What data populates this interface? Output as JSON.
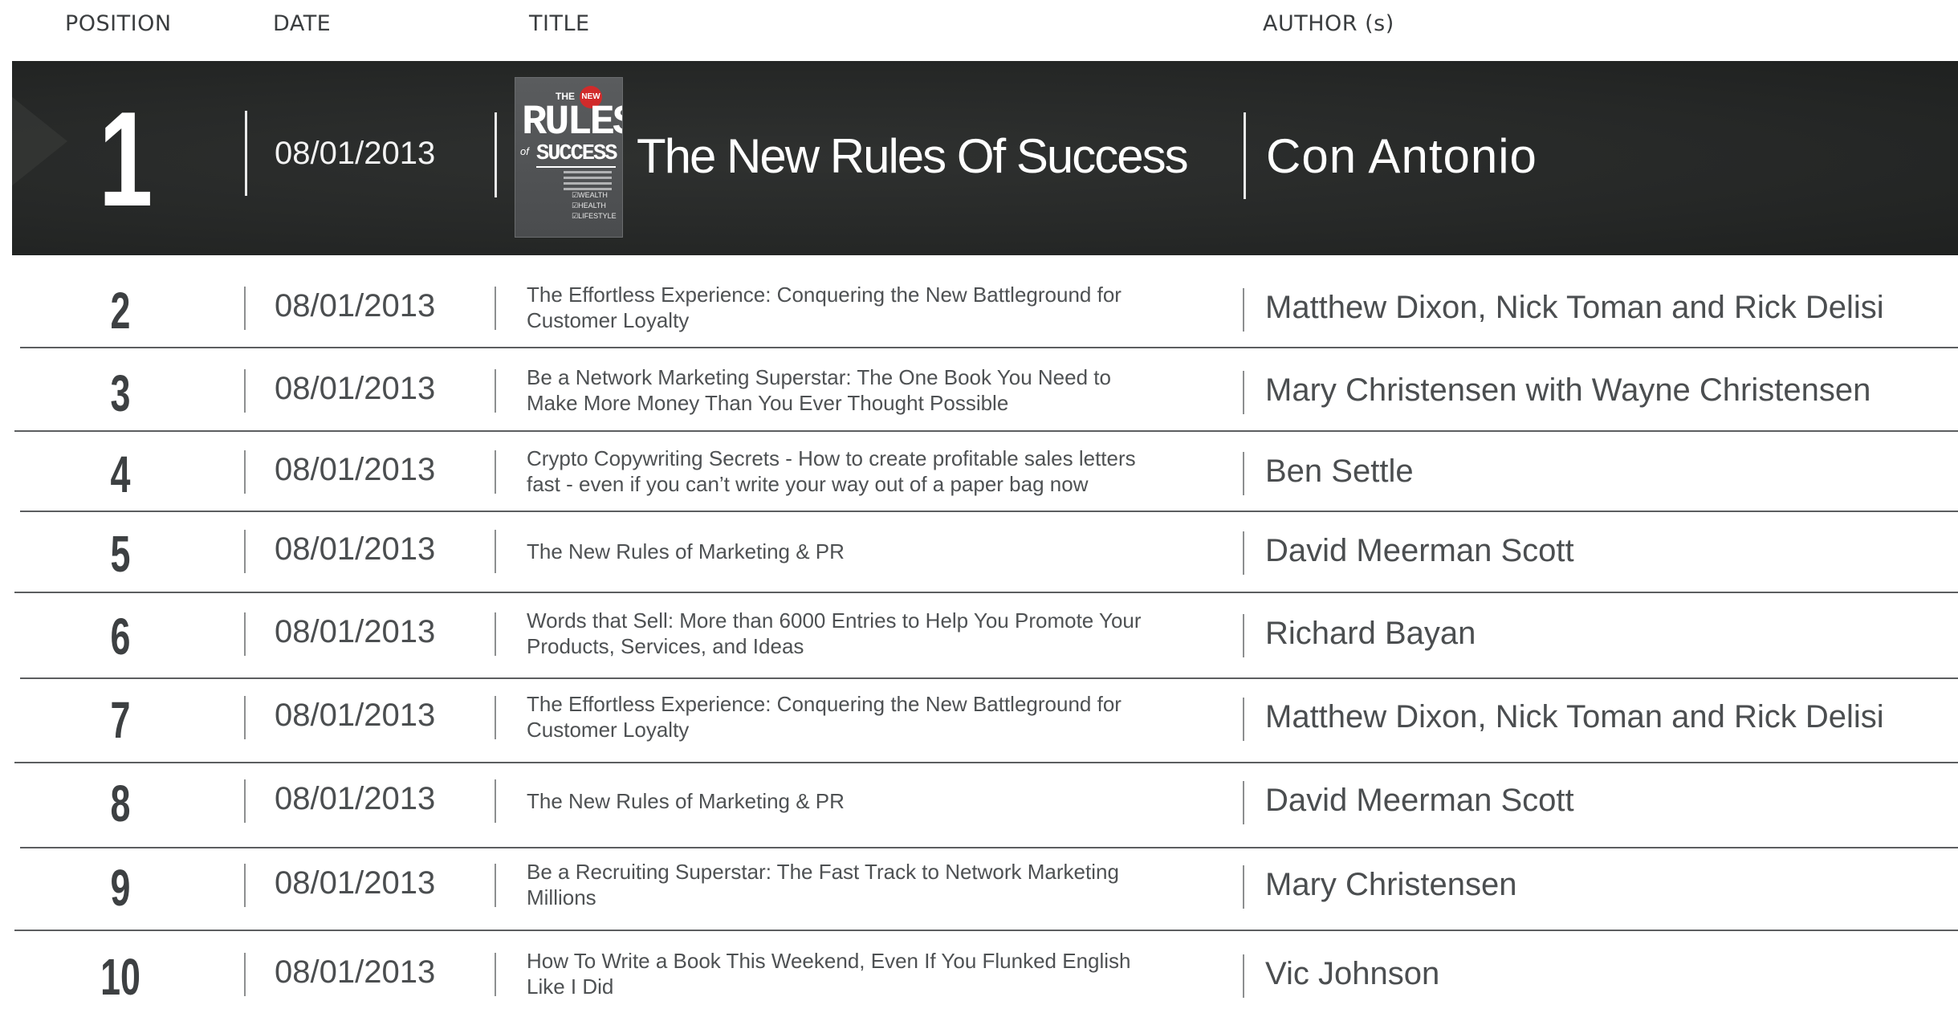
{
  "headers": {
    "position": "POSITION",
    "date": "DATE",
    "title": "TITLE",
    "author": "AUTHOR (s)"
  },
  "featured": {
    "position": "1",
    "date": "08/01/2013",
    "title": "The New Rules Of Success",
    "author": "Con Antonio",
    "cover": {
      "the": "THE",
      "new": "NEW",
      "rules": "RULES",
      "of": "of",
      "success": "SUCCESS",
      "checks": [
        "☑WEALTH",
        "☑HEALTH",
        "☑LIFESTYLE"
      ]
    }
  },
  "rows": [
    {
      "position": "2",
      "date": "08/01/2013",
      "title_line1": "The Effortless Experience: Conquering the New Battleground for",
      "title_line2": "Customer Loyalty",
      "author": "Matthew Dixon, Nick Toman and Rick Delisi"
    },
    {
      "position": "3",
      "date": "08/01/2013",
      "title_line1": "Be a Network Marketing Superstar: The One Book You Need to",
      "title_line2": "Make More Money Than You Ever Thought Possible",
      "author": "Mary Christensen with Wayne Christensen"
    },
    {
      "position": "4",
      "date": "08/01/2013",
      "title_line1": "Crypto Copywriting Secrets - How to create profitable sales letters",
      "title_line2": "fast - even if you can’t write your way out of a paper bag now",
      "author": "Ben Settle"
    },
    {
      "position": "5",
      "date": "08/01/2013",
      "title_line1": "The New Rules of Marketing & PR",
      "title_line2": "",
      "author": "David Meerman Scott"
    },
    {
      "position": "6",
      "date": "08/01/2013",
      "title_line1": "Words that Sell: More than 6000 Entries to Help You Promote Your",
      "title_line2": "Products, Services, and Ideas",
      "author": "Richard Bayan"
    },
    {
      "position": "7",
      "date": "08/01/2013",
      "title_line1": "The Effortless Experience: Conquering the New Battleground for",
      "title_line2": "Customer Loyalty",
      "author": "Matthew Dixon, Nick Toman and Rick Delisi"
    },
    {
      "position": "8",
      "date": "08/01/2013",
      "title_line1": "The New Rules of Marketing & PR",
      "title_line2": "",
      "author": "David Meerman Scott"
    },
    {
      "position": "9",
      "date": "08/01/2013",
      "title_line1": "Be a Recruiting Superstar: The Fast Track to Network Marketing",
      "title_line2": "Millions",
      "author": "Mary Christensen"
    },
    {
      "position": "10",
      "date": "08/01/2013",
      "title_line1": "How To Write a Book This Weekend, Even If You Flunked English",
      "title_line2": "Like I Did",
      "author": "Vic Johnson"
    }
  ]
}
